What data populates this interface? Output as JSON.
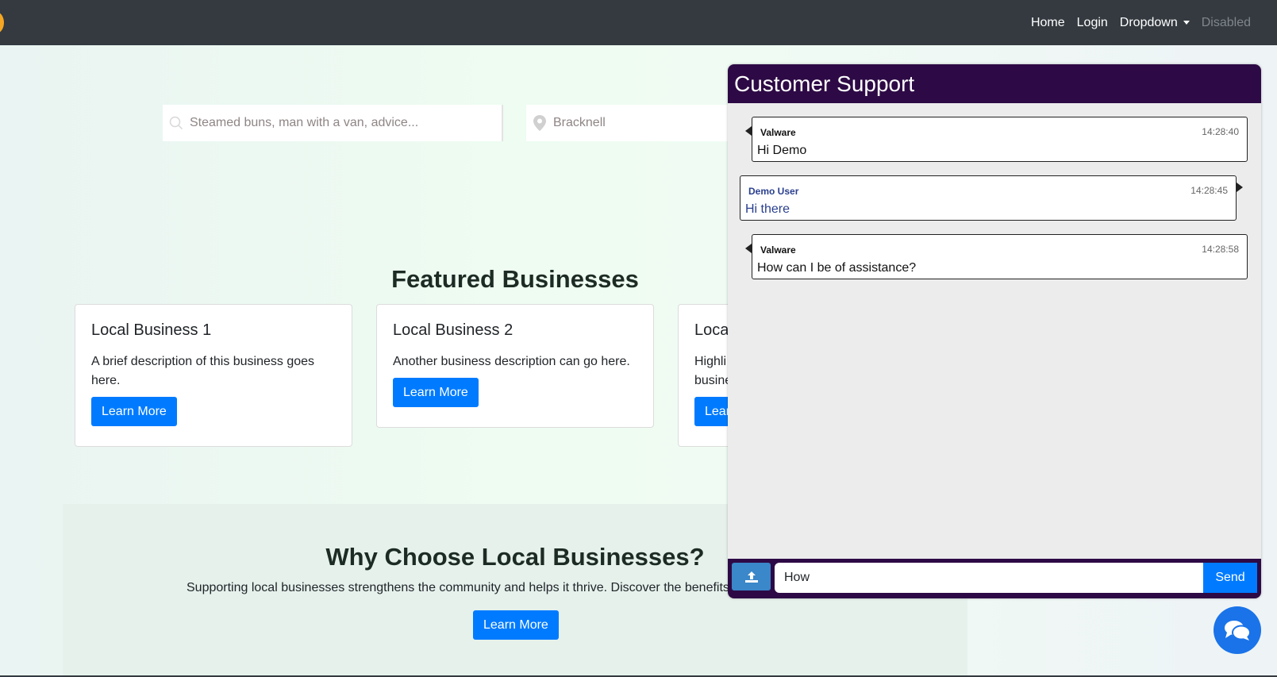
{
  "nav": {
    "links": [
      "Home",
      "Login",
      "Dropdown",
      "Disabled"
    ]
  },
  "search": {
    "what_placeholder": "Steamed buns, man with a van, advice...",
    "where_value": "Bracknell"
  },
  "featured": {
    "title": "Featured Businesses",
    "cards": [
      {
        "title": "Local Business 1",
        "description": "A brief description of this business goes here.",
        "button": "Learn More"
      },
      {
        "title": "Local Business 2",
        "description": "Another business description can go here.",
        "button": "Learn More"
      },
      {
        "title": "Loca",
        "description": "Highli busine",
        "button": "Lear"
      }
    ]
  },
  "why": {
    "title": "Why Choose Local Businesses?",
    "text": "Supporting local businesses strengthens the community and helps it thrive. Discover the benefits",
    "button": "Learn More"
  },
  "chat": {
    "title": "Customer Support",
    "messages": [
      {
        "sender": "Valware",
        "time": "14:28:40",
        "text": "Hi Demo"
      },
      {
        "sender": "Demo User",
        "time": "14:28:45",
        "text": "Hi there"
      },
      {
        "sender": "Valware",
        "time": "14:28:58",
        "text": "How can I be of assistance?"
      }
    ],
    "input_value": "How",
    "send_label": "Send"
  },
  "colors": {
    "navbar": "#343a40",
    "primary": "#007bff",
    "chat_header": "#2d0a45"
  }
}
